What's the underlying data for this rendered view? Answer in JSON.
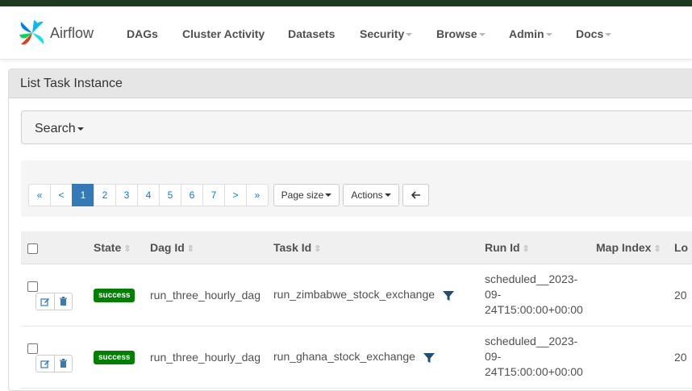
{
  "app": {
    "name": "Airflow"
  },
  "nav": {
    "items": [
      {
        "label": "DAGs",
        "dropdown": false
      },
      {
        "label": "Cluster Activity",
        "dropdown": false
      },
      {
        "label": "Datasets",
        "dropdown": false
      },
      {
        "label": "Security",
        "dropdown": true
      },
      {
        "label": "Browse",
        "dropdown": true
      },
      {
        "label": "Admin",
        "dropdown": true
      },
      {
        "label": "Docs",
        "dropdown": true
      }
    ]
  },
  "panel": {
    "title": "List Task Instance"
  },
  "search": {
    "label": "Search"
  },
  "pagination": {
    "first": "«",
    "prev": "<",
    "pages": [
      "1",
      "2",
      "3",
      "4",
      "5",
      "6",
      "7"
    ],
    "active_page": "1",
    "next": ">",
    "last": "»",
    "page_size_label": "Page size",
    "actions_label": "Actions",
    "back_icon": "arrow-left-icon"
  },
  "table": {
    "columns": [
      "State",
      "Dag Id",
      "Task Id",
      "Run Id",
      "Map Index",
      "Lo"
    ],
    "rows": [
      {
        "state": "success",
        "dag_id": "run_three_hourly_dag",
        "task_id": "run_zimbabwe_stock_exchange",
        "run_id": "scheduled__2023-\n09-\n24T15:00:00+00:00",
        "map_index": "",
        "log_partial": "20"
      },
      {
        "state": "success",
        "dag_id": "run_three_hourly_dag",
        "task_id": "run_ghana_stock_exchange",
        "run_id": "scheduled__2023-\n09-\n24T15:00:00+00:00",
        "map_index": "",
        "log_partial": "20"
      }
    ]
  },
  "colors": {
    "success": "#008000",
    "active_page": "#337ab7",
    "link": "#017cee",
    "filter_icon": "#1f4e79"
  }
}
